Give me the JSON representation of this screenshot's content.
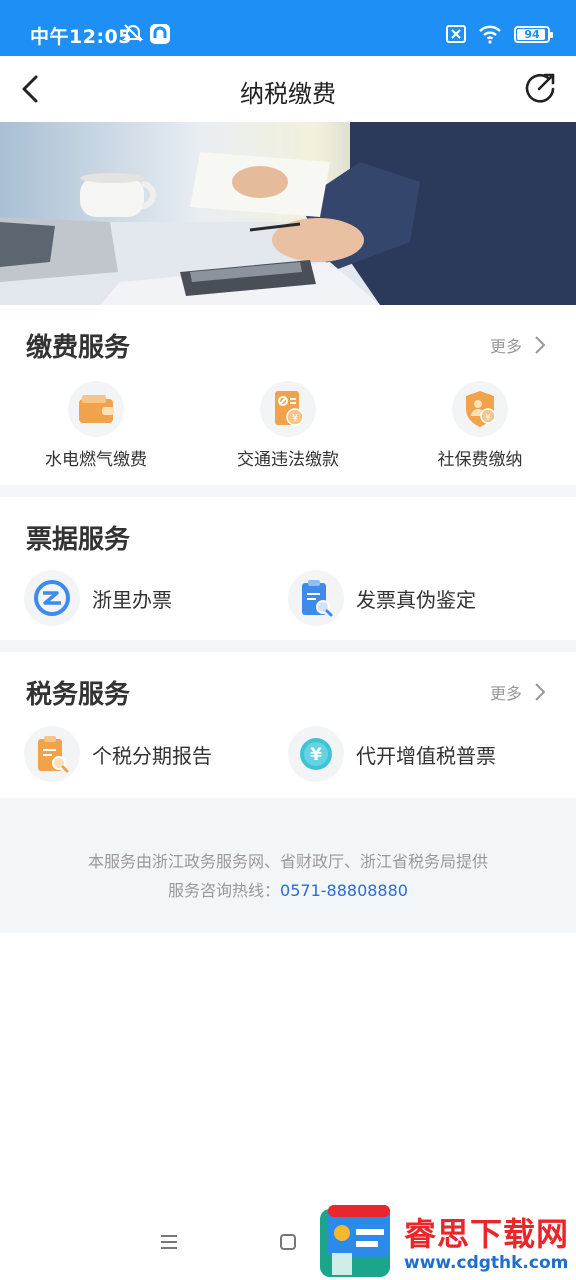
{
  "status_bar": {
    "time": "中午12:05",
    "battery": "94",
    "battery_level_percent": 94
  },
  "navbar": {
    "title": "纳税缴费"
  },
  "fee_services": {
    "title": "缴费服务",
    "more": "更多",
    "items": [
      {
        "label": "水电燃气缴费",
        "icon": "wallet-icon"
      },
      {
        "label": "交通违法缴款",
        "icon": "traffic-fine-icon"
      },
      {
        "label": "社保费缴纳",
        "icon": "social-security-icon"
      }
    ]
  },
  "invoice_services": {
    "title": "票据服务",
    "items": [
      {
        "label": "浙里办票",
        "icon": "zhelibanpiao-logo-icon"
      },
      {
        "label": "发票真伪鉴定",
        "icon": "invoice-verify-icon"
      }
    ]
  },
  "tax_services": {
    "title": "税务服务",
    "more": "更多",
    "items": [
      {
        "label": "个税分期报告",
        "icon": "tax-report-icon"
      },
      {
        "label": "代开增值税普票",
        "icon": "yuan-coin-icon"
      }
    ]
  },
  "footer": {
    "line1": "本服务由浙江政务服务网、省财政厅、浙江省税务局提供",
    "hotline_label": "服务咨询热线：",
    "hotline_number": "0571-88808880"
  },
  "watermark": {
    "brand": "睿思下载网",
    "url": "www.cdgthk.com"
  },
  "colors": {
    "status_bar": "#1e90f5",
    "icon_orange": "#f0a34a",
    "icon_blue": "#3d8bea",
    "link_blue": "#2e6bd6"
  }
}
